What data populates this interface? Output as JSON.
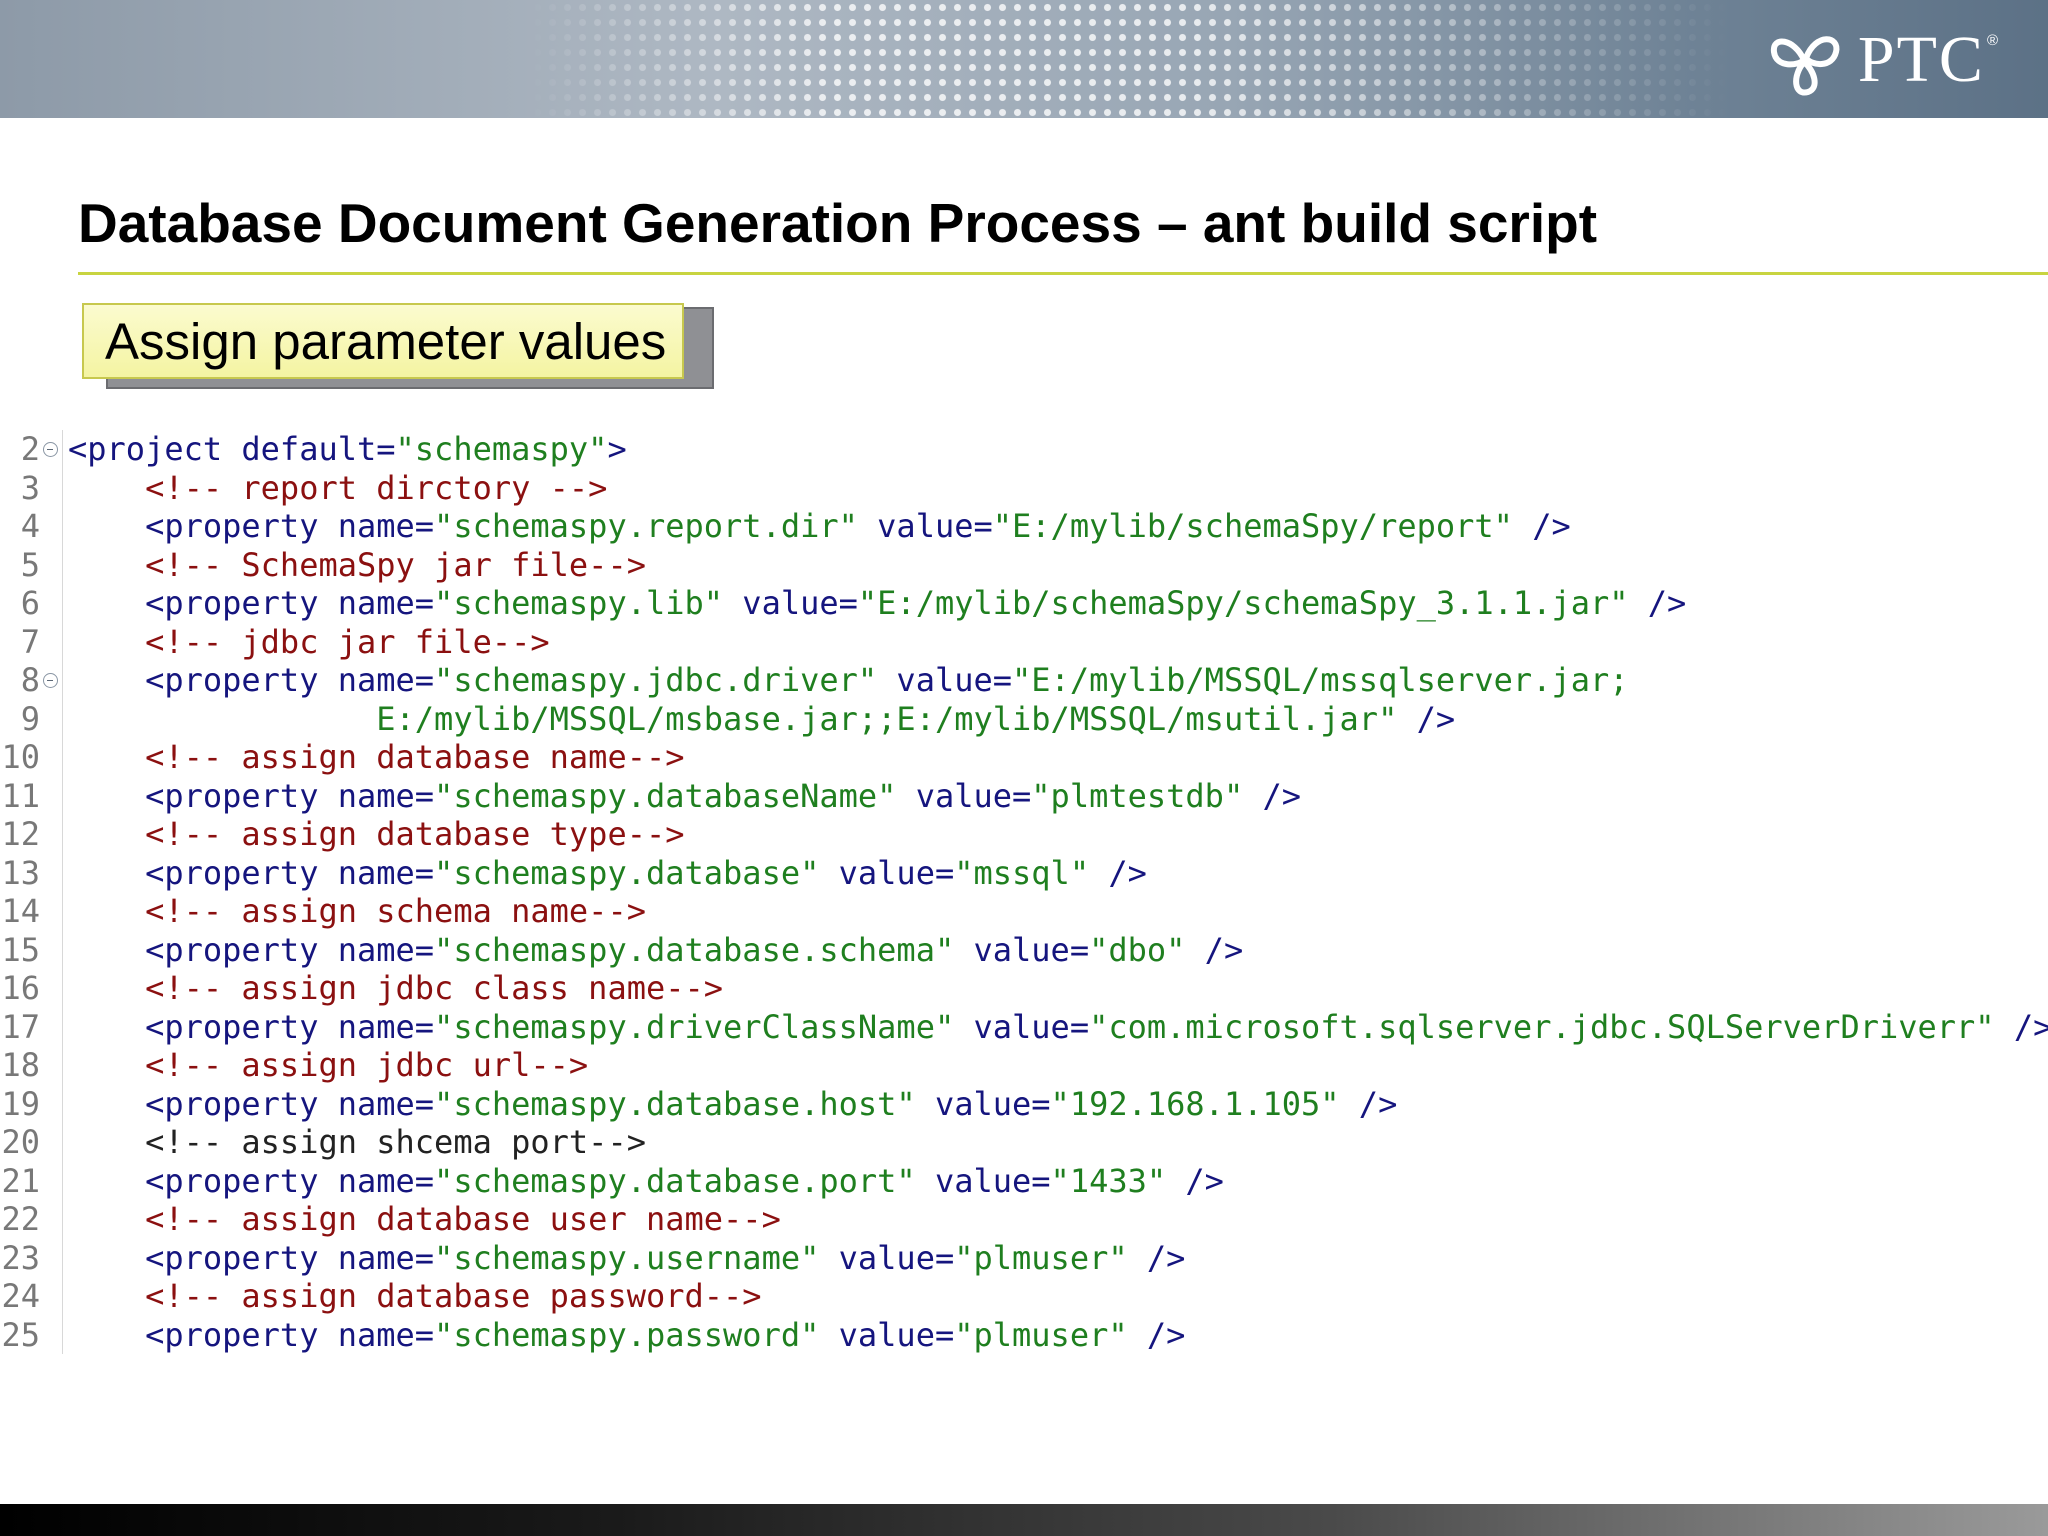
{
  "header": {
    "logo_text": "PTC",
    "logo_mark": "®",
    "logo_icon": "ptc-swirl-icon"
  },
  "slide": {
    "title": "Database Document Generation Process – ant build script",
    "callout": "Assign parameter values"
  },
  "code": {
    "lines": [
      {
        "n": "2",
        "fold": true,
        "indent": "",
        "parts": [
          [
            "tag",
            "<project "
          ],
          [
            "attr",
            "default="
          ],
          [
            "val",
            "\"schemaspy\""
          ],
          [
            "tag",
            ">"
          ]
        ]
      },
      {
        "n": "3",
        "fold": false,
        "indent": "    ",
        "parts": [
          [
            "cmt",
            "<!-- report dirctory -->"
          ]
        ]
      },
      {
        "n": "4",
        "fold": false,
        "indent": "    ",
        "parts": [
          [
            "tag",
            "<property "
          ],
          [
            "attr",
            "name="
          ],
          [
            "val",
            "\"schemaspy.report.dir\""
          ],
          [
            "attr",
            " value="
          ],
          [
            "val",
            "\"E:/mylib/schemaSpy/report\""
          ],
          [
            "tag",
            " />"
          ]
        ]
      },
      {
        "n": "5",
        "fold": false,
        "indent": "    ",
        "parts": [
          [
            "cmt",
            "<!-- SchemaSpy jar file-->"
          ]
        ]
      },
      {
        "n": "6",
        "fold": false,
        "indent": "    ",
        "parts": [
          [
            "tag",
            "<property "
          ],
          [
            "attr",
            "name="
          ],
          [
            "val",
            "\"schemaspy.lib\""
          ],
          [
            "attr",
            " value="
          ],
          [
            "val",
            "\"E:/mylib/schemaSpy/schemaSpy_3.1.1.jar\""
          ],
          [
            "tag",
            " />"
          ]
        ]
      },
      {
        "n": "7",
        "fold": false,
        "indent": "    ",
        "parts": [
          [
            "cmt",
            "<!-- jdbc jar file-->"
          ]
        ]
      },
      {
        "n": "8",
        "fold": true,
        "indent": "    ",
        "parts": [
          [
            "tag",
            "<property "
          ],
          [
            "attr",
            "name="
          ],
          [
            "val",
            "\"schemaspy.jdbc.driver\""
          ],
          [
            "attr",
            " value="
          ],
          [
            "val",
            "\"E:/mylib/MSSQL/mssqlserver.jar;"
          ]
        ]
      },
      {
        "n": "9",
        "fold": false,
        "indent": "                ",
        "parts": [
          [
            "val",
            "E:/mylib/MSSQL/msbase.jar;;E:/mylib/MSSQL/msutil.jar\""
          ],
          [
            "tag",
            " />"
          ]
        ]
      },
      {
        "n": "10",
        "fold": false,
        "indent": "    ",
        "parts": [
          [
            "cmt",
            "<!-- assign database name-->"
          ]
        ]
      },
      {
        "n": "11",
        "fold": false,
        "indent": "    ",
        "parts": [
          [
            "tag",
            "<property "
          ],
          [
            "attr",
            "name="
          ],
          [
            "val",
            "\"schemaspy.databaseName\""
          ],
          [
            "attr",
            " value="
          ],
          [
            "val",
            "\"plmtestdb\""
          ],
          [
            "tag",
            " />"
          ]
        ]
      },
      {
        "n": "12",
        "fold": false,
        "indent": "    ",
        "parts": [
          [
            "cmt",
            "<!-- assign database type-->"
          ]
        ]
      },
      {
        "n": "13",
        "fold": false,
        "indent": "    ",
        "parts": [
          [
            "tag",
            "<property "
          ],
          [
            "attr",
            "name="
          ],
          [
            "val",
            "\"schemaspy.database\""
          ],
          [
            "attr",
            " value="
          ],
          [
            "val",
            "\"mssql\""
          ],
          [
            "tag",
            " />"
          ]
        ]
      },
      {
        "n": "14",
        "fold": false,
        "indent": "    ",
        "parts": [
          [
            "cmt",
            "<!-- assign schema name-->"
          ]
        ]
      },
      {
        "n": "15",
        "fold": false,
        "indent": "    ",
        "parts": [
          [
            "tag",
            "<property "
          ],
          [
            "attr",
            "name="
          ],
          [
            "val",
            "\"schemaspy.database.schema\""
          ],
          [
            "attr",
            " value="
          ],
          [
            "val",
            "\"dbo\""
          ],
          [
            "tag",
            " />"
          ]
        ]
      },
      {
        "n": "16",
        "fold": false,
        "indent": "    ",
        "parts": [
          [
            "cmt",
            "<!-- assign jdbc class name-->"
          ]
        ]
      },
      {
        "n": "17",
        "fold": false,
        "indent": "    ",
        "parts": [
          [
            "tag",
            "<property "
          ],
          [
            "attr",
            "name="
          ],
          [
            "val",
            "\"schemaspy.driverClassName\""
          ],
          [
            "attr",
            " value="
          ],
          [
            "val",
            "\"com.microsoft.sqlserver.jdbc.SQLServerDriverr\""
          ],
          [
            "tag",
            " />"
          ]
        ]
      },
      {
        "n": "18",
        "fold": false,
        "indent": "    ",
        "parts": [
          [
            "cmt",
            "<!-- assign jdbc url-->"
          ]
        ]
      },
      {
        "n": "19",
        "fold": false,
        "indent": "    ",
        "parts": [
          [
            "tag",
            "<property "
          ],
          [
            "attr",
            "name="
          ],
          [
            "val",
            "\"schemaspy.database.host\""
          ],
          [
            "attr",
            " value="
          ],
          [
            "val",
            "\"192.168.1.105\""
          ],
          [
            "tag",
            " />"
          ]
        ]
      },
      {
        "n": "20",
        "fold": false,
        "indent": "    ",
        "parts": [
          [
            "cmt-dark",
            "<!-- assign shcema port-->"
          ]
        ]
      },
      {
        "n": "21",
        "fold": false,
        "indent": "    ",
        "parts": [
          [
            "tag",
            "<property "
          ],
          [
            "attr",
            "name="
          ],
          [
            "val",
            "\"schemaspy.database.port\""
          ],
          [
            "attr",
            " value="
          ],
          [
            "val",
            "\"1433\""
          ],
          [
            "tag",
            " />"
          ]
        ]
      },
      {
        "n": "22",
        "fold": false,
        "indent": "    ",
        "parts": [
          [
            "cmt",
            "<!-- assign database user name-->"
          ]
        ]
      },
      {
        "n": "23",
        "fold": false,
        "indent": "    ",
        "parts": [
          [
            "tag",
            "<property "
          ],
          [
            "attr",
            "name="
          ],
          [
            "val",
            "\"schemaspy.username\""
          ],
          [
            "attr",
            " value="
          ],
          [
            "val",
            "\"plmuser\""
          ],
          [
            "tag",
            " />"
          ]
        ]
      },
      {
        "n": "24",
        "fold": false,
        "indent": "    ",
        "parts": [
          [
            "cmt",
            "<!-- assign database password-->"
          ]
        ]
      },
      {
        "n": "25",
        "fold": false,
        "indent": "    ",
        "parts": [
          [
            "tag",
            "<property "
          ],
          [
            "attr",
            "name="
          ],
          [
            "val",
            "\"schemaspy.password\""
          ],
          [
            "attr",
            " value="
          ],
          [
            "val",
            "\"plmuser\""
          ],
          [
            "tag",
            " />"
          ]
        ]
      }
    ]
  },
  "colors": {
    "tag": "#15157e",
    "attribute_value": "#1f7f1f",
    "comment": "#8b1010",
    "title_rule": "#c8d440",
    "callout_fill": "#f6f6b0"
  }
}
